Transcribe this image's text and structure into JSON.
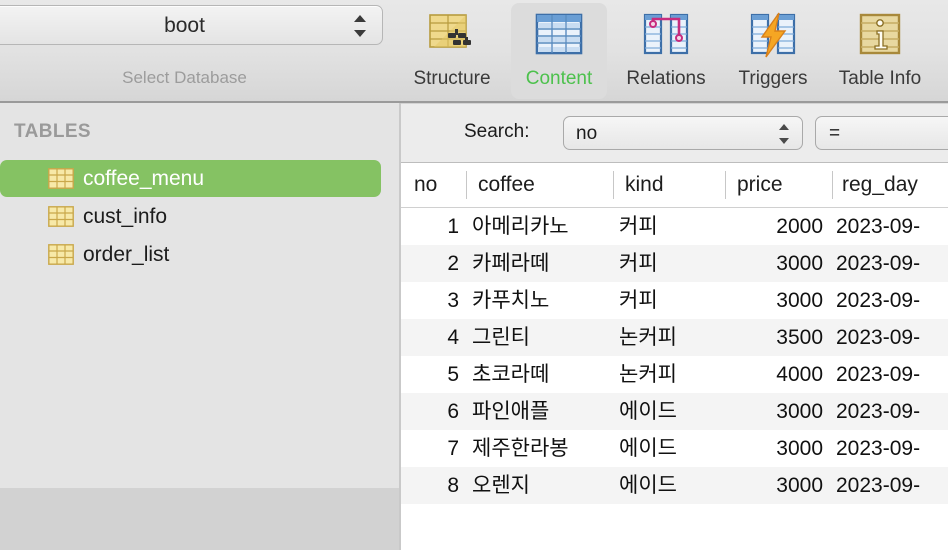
{
  "toolbar": {
    "database_popup": {
      "value": "boot",
      "caption": "Select Database",
      "icon": "updown-chevron-icon"
    },
    "tabs": [
      {
        "label": "Structure",
        "icon": "table-structure-icon",
        "selected": false
      },
      {
        "label": "Content",
        "icon": "table-content-icon",
        "selected": true
      },
      {
        "label": "Relations",
        "icon": "table-relations-icon",
        "selected": false
      },
      {
        "label": "Triggers",
        "icon": "table-triggers-icon",
        "selected": false
      },
      {
        "label": "Table Info",
        "icon": "table-info-icon",
        "selected": false
      }
    ]
  },
  "sidebar": {
    "header": "TABLES",
    "items": [
      {
        "label": "coffee_menu",
        "icon": "table-icon",
        "selected": true
      },
      {
        "label": "cust_info",
        "icon": "table-icon",
        "selected": false
      },
      {
        "label": "order_list",
        "icon": "table-icon",
        "selected": false
      }
    ]
  },
  "search": {
    "label": "Search:",
    "field": {
      "value": "no",
      "icon": "updown-chevron-icon"
    },
    "operator": {
      "value": "=",
      "icon": "updown-chevron-icon"
    }
  },
  "grid": {
    "columns": [
      "no",
      "coffee",
      "kind",
      "price",
      "reg_day"
    ],
    "rows": [
      {
        "no": "1",
        "coffee": "아메리카노",
        "kind": "커피",
        "price": "2000",
        "reg_day": "2023-09-"
      },
      {
        "no": "2",
        "coffee": "카페라떼",
        "kind": "커피",
        "price": "3000",
        "reg_day": "2023-09-"
      },
      {
        "no": "3",
        "coffee": "카푸치노",
        "kind": "커피",
        "price": "3000",
        "reg_day": "2023-09-"
      },
      {
        "no": "4",
        "coffee": "그린티",
        "kind": "논커피",
        "price": "3500",
        "reg_day": "2023-09-"
      },
      {
        "no": "5",
        "coffee": "초코라떼",
        "kind": "논커피",
        "price": "4000",
        "reg_day": "2023-09-"
      },
      {
        "no": "6",
        "coffee": "파인애플",
        "kind": "에이드",
        "price": "3000",
        "reg_day": "2023-09-"
      },
      {
        "no": "7",
        "coffee": "제주한라봉",
        "kind": "에이드",
        "price": "3000",
        "reg_day": "2023-09-"
      },
      {
        "no": "8",
        "coffee": "오렌지",
        "kind": "에이드",
        "price": "3000",
        "reg_day": "2023-09-"
      }
    ]
  },
  "colors": {
    "selection_green": "#85c263",
    "active_tab_text": "#4cc14c",
    "toolbar_bg": "#e2e2e2",
    "sidebar_bg": "#e4e4e4",
    "row_alt_bg": "#f4f4f4"
  }
}
